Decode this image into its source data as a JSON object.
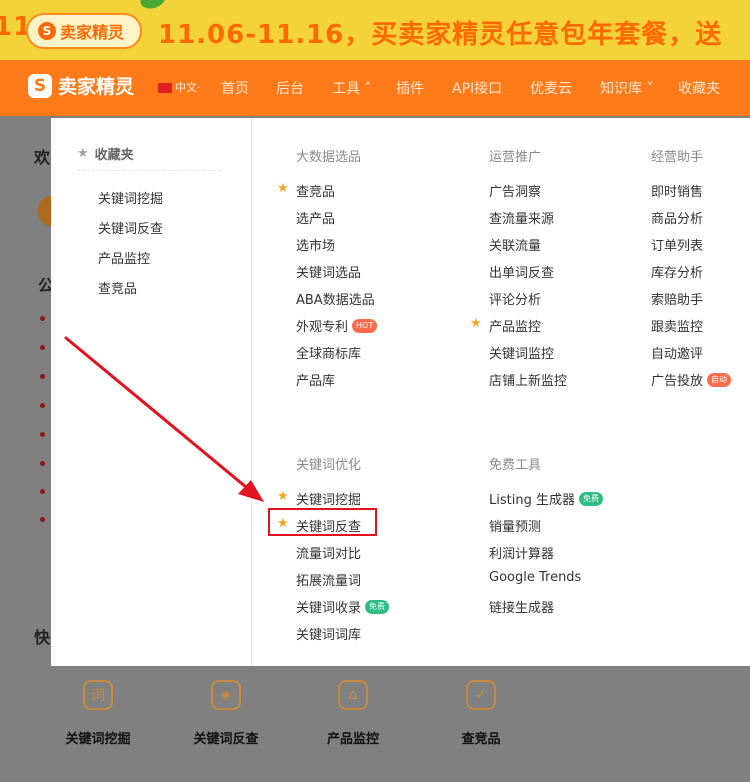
{
  "banner": {
    "left_fragment": "11",
    "pill_logo": "S",
    "pill_text": "卖家精灵",
    "promo": "11.06-11.16，买卖家精灵任意包年套餐，送"
  },
  "nav": {
    "logo_mark": "S",
    "logo_text": "卖家精灵",
    "lang": "中文·",
    "items": [
      "首页",
      "后台",
      "工具 ˄",
      "插件",
      "API接口",
      "优麦云",
      "知识库 ˅",
      "收藏夹"
    ]
  },
  "page": {
    "frag_welcome": "欢",
    "frag_notice": "公",
    "frag_quick": "快",
    "quick_items": [
      {
        "label": "关键词挖掘",
        "icon": "词"
      },
      {
        "label": "关键词反查",
        "icon": "◈"
      },
      {
        "label": "产品监控",
        "icon": "⌂"
      },
      {
        "label": "查竞品",
        "icon": "✓"
      }
    ]
  },
  "favorites": {
    "title": "收藏夹",
    "items": [
      "关键词挖掘",
      "关键词反查",
      "产品监控",
      "查竞品"
    ]
  },
  "menu": {
    "big_data": {
      "title": "大数据选品",
      "items": [
        {
          "label": "查竞品",
          "star": true
        },
        {
          "label": "选产品"
        },
        {
          "label": "选市场"
        },
        {
          "label": "关键词选品"
        },
        {
          "label": "ABA数据选品"
        },
        {
          "label": "外观专利",
          "badge": "HOT"
        },
        {
          "label": "全球商标库"
        },
        {
          "label": "产品库"
        }
      ]
    },
    "ops": {
      "title": "运营推广",
      "items": [
        {
          "label": "广告洞察"
        },
        {
          "label": "查流量来源"
        },
        {
          "label": "关联流量"
        },
        {
          "label": "出单词反查"
        },
        {
          "label": "评论分析"
        },
        {
          "label": "产品监控",
          "star": true
        },
        {
          "label": "关键词监控"
        },
        {
          "label": "店铺上新监控"
        }
      ]
    },
    "assistant": {
      "title": "经营助手",
      "items": [
        {
          "label": "即时销售"
        },
        {
          "label": "商品分析"
        },
        {
          "label": "订单列表"
        },
        {
          "label": "库存分析"
        },
        {
          "label": "索赔助手"
        },
        {
          "label": "跟卖监控"
        },
        {
          "label": "自动邀评"
        },
        {
          "label": "广告投放",
          "badge": "自动"
        }
      ]
    },
    "keyword": {
      "title": "关键词优化",
      "items": [
        {
          "label": "关键词挖掘",
          "star": true
        },
        {
          "label": "关键词反查",
          "star": true
        },
        {
          "label": "流量词对比"
        },
        {
          "label": "拓展流量词"
        },
        {
          "label": "关键词收录",
          "badge": "免费"
        },
        {
          "label": "关键词词库"
        }
      ]
    },
    "free": {
      "title": "免费工具",
      "items": [
        {
          "label": "Listing 生成器",
          "badge": "免费"
        },
        {
          "label": "销量预测"
        },
        {
          "label": "利润计算器"
        },
        {
          "label": "Google Trends"
        },
        {
          "label": "链接生成器"
        }
      ]
    }
  },
  "colors": {
    "brand": "#ff7b1a",
    "highlight": "#e0121f",
    "star": "#f4a623"
  }
}
